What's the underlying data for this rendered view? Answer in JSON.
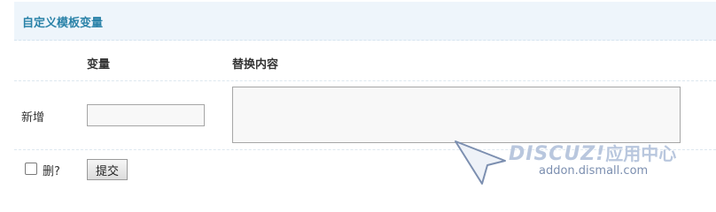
{
  "panel": {
    "title": "自定义模板变量"
  },
  "columns": {
    "variable": "变量",
    "replacement": "替换内容"
  },
  "new_row": {
    "label": "新增",
    "variable_value": "",
    "replacement_value": ""
  },
  "actions": {
    "delete_label": "删?",
    "delete_checked": false,
    "submit_label": "提交"
  },
  "watermark": {
    "brand": "DISCUZ!",
    "brand_cn": "应用中心",
    "url": "addon.dismall.com"
  },
  "colors": {
    "header_bg": "#eef5fb",
    "title": "#2a82a8",
    "watermark": "#b9c7de"
  }
}
